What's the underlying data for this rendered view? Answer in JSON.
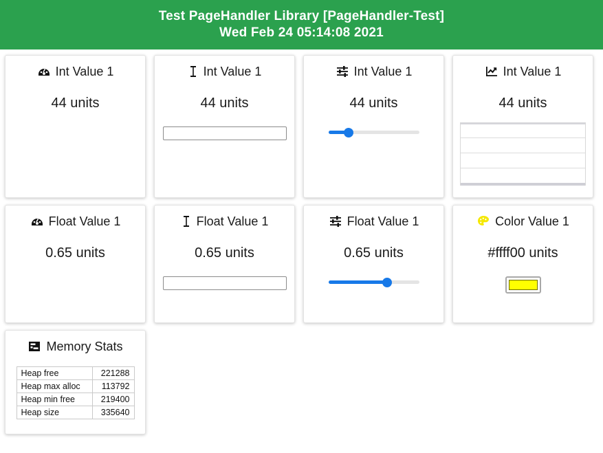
{
  "header": {
    "title": "Test PageHandler Library [PageHandler-Test]",
    "timestamp": "Wed Feb 24 05:14:08 2021",
    "background_color": "#2ba14e",
    "text_color": "#ffffff"
  },
  "accent_color": "#1779e8",
  "cards": [
    {
      "id": "int-value-1-gauge",
      "icon": "gauge-icon",
      "title": "Int Value 1",
      "value": "44 units",
      "widget": "none"
    },
    {
      "id": "int-value-1-text",
      "icon": "text-cursor-icon",
      "title": "Int Value 1",
      "value": "44 units",
      "widget": "text-input",
      "input_value": "",
      "input_placeholder": ""
    },
    {
      "id": "int-value-1-slider",
      "icon": "sliders-icon",
      "title": "Int Value 1",
      "value": "44 units",
      "widget": "slider",
      "slider_percent": 22
    },
    {
      "id": "int-value-1-chart",
      "icon": "line-chart-icon",
      "title": "Int Value 1",
      "value": "44 units",
      "widget": "chart"
    },
    {
      "id": "float-value-1-gauge",
      "icon": "gauge-icon",
      "title": "Float Value 1",
      "value": "0.65 units",
      "widget": "none"
    },
    {
      "id": "float-value-1-text",
      "icon": "text-cursor-icon",
      "title": "Float Value 1",
      "value": "0.65 units",
      "widget": "text-input",
      "input_value": "",
      "input_placeholder": ""
    },
    {
      "id": "float-value-1-slider",
      "icon": "sliders-icon",
      "title": "Float Value 1",
      "value": "0.65 units",
      "widget": "slider",
      "slider_percent": 65
    },
    {
      "id": "color-value-1",
      "icon": "palette-icon",
      "title": "Color Value 1",
      "value": "#ffff00 units",
      "widget": "color-swatch",
      "color": "#ffff00"
    }
  ],
  "memory_stats": {
    "icon": "memory-icon",
    "title": "Memory Stats",
    "rows": [
      {
        "label": "Heap free",
        "value": "221288"
      },
      {
        "label": "Heap max alloc",
        "value": "113792"
      },
      {
        "label": "Heap min free",
        "value": "219400"
      },
      {
        "label": "Heap size",
        "value": "335640"
      }
    ]
  },
  "chart_data": {
    "type": "line",
    "title": "Int Value 1",
    "series": [
      {
        "name": "Int Value 1",
        "values": []
      }
    ],
    "x": [],
    "ylim": [
      0,
      100
    ],
    "grid": true,
    "gridlines": 4,
    "legend": "none",
    "xlabel": "",
    "ylabel": ""
  }
}
